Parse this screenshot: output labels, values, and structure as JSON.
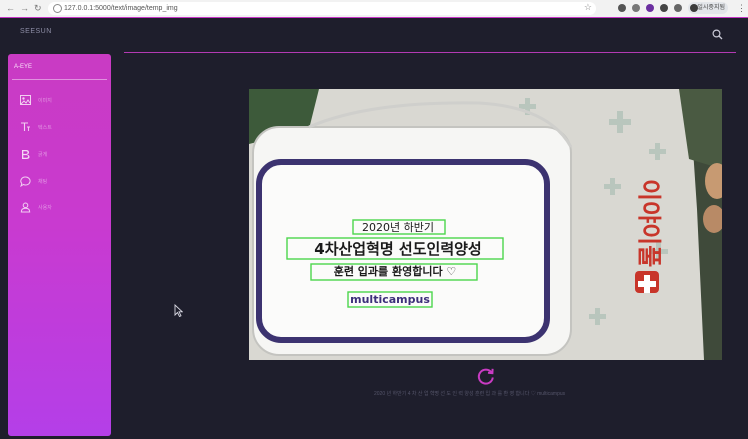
{
  "browser": {
    "url": "127.0.0.1:5000/text/image/temp_img",
    "profile_label": "일시중지됨"
  },
  "app": {
    "brand": "SEESUN"
  },
  "sidebar": {
    "title": "A-EYE",
    "items": [
      {
        "icon": "image-icon",
        "label": "이미지"
      },
      {
        "icon": "text-icon",
        "label": "텍스트"
      },
      {
        "icon": "bold-icon",
        "label": "굵게"
      },
      {
        "icon": "chat-icon",
        "label": "채팅"
      },
      {
        "icon": "user-icon",
        "label": "사용자"
      }
    ]
  },
  "photo": {
    "ocr_lines": [
      {
        "text": "2020년 하반기"
      },
      {
        "text": "4차산업혁명 선도인력양성"
      },
      {
        "text": "훈련 입과를 환영합니다 ♡"
      },
      {
        "text": "multicampus"
      }
    ],
    "package_brand": "이야이풀"
  },
  "result": {
    "caption": "2020 년 하반기 4 차 산 업 혁명 선 도 인 력 양성 훈련 입 과 를 환 영 합니다 ♡ multicampus"
  },
  "colors": {
    "accent": "#c93bc3",
    "page_bg": "#1e1e2c",
    "ocr_box": "#4cd64c"
  }
}
